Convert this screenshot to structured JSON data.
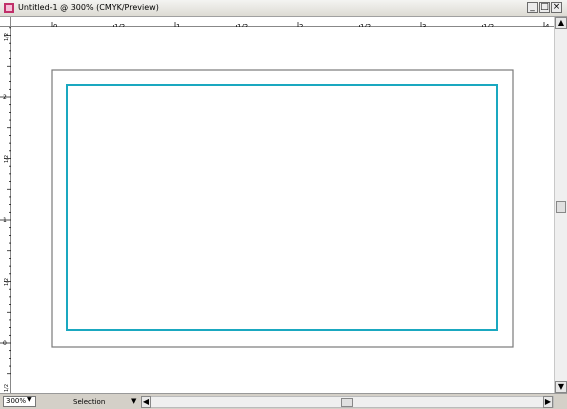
{
  "window": {
    "title": "Untitled-1 @ 300% (CMYK/Preview)",
    "minimize_label": "_",
    "maximize_label": "□",
    "close_label": "×"
  },
  "ruler": {
    "horizontal_labels": [
      "0",
      "1/2",
      "1",
      "1/2",
      "2",
      "1/2",
      "3",
      "1/2",
      "4"
    ],
    "vertical_labels": [
      "1/2",
      "2",
      "1/2",
      "1",
      "1/2",
      "0",
      "1/2"
    ]
  },
  "status": {
    "zoom": "300%",
    "tool": "Selection"
  },
  "colors": {
    "trim_border": "#7a7a7a",
    "bleed_guide": "#1aa8c0"
  }
}
